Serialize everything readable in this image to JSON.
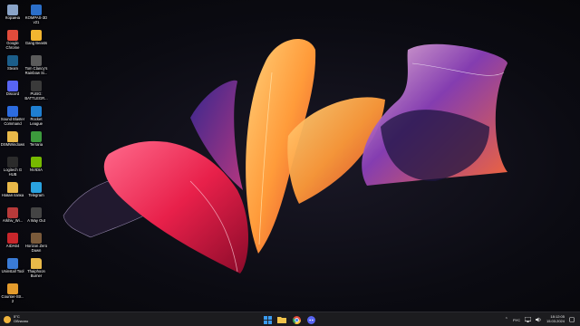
{
  "desktop": {
    "icons": [
      {
        "label": "Корзина",
        "icon": "recycle-bin-icon",
        "color": "#8aa4c8"
      },
      {
        "label": "KOMPAS-3D v21",
        "icon": "kompas-icon",
        "color": "#2b6fc9"
      },
      {
        "label": "Google Chrome",
        "icon": "chrome-icon",
        "color": "#e14b3b"
      },
      {
        "label": "Gang Beasts",
        "icon": "gang-beasts-icon",
        "color": "#f2b530"
      },
      {
        "label": "Steam",
        "icon": "steam-icon",
        "color": "#1b5e8a"
      },
      {
        "label": "Tom Clancy's Rainbow Si...",
        "icon": "rainbow-six-icon",
        "color": "#5b5b5b"
      },
      {
        "label": "Discord",
        "icon": "discord-icon",
        "color": "#5865f2"
      },
      {
        "label": "PUBG: BATTLEGR...",
        "icon": "pubg-icon",
        "color": "#3a3a3a"
      },
      {
        "label": "Sound Blaster Command",
        "icon": "sound-blaster-icon",
        "color": "#2d6cdf"
      },
      {
        "label": "Rocket League",
        "icon": "rocket-league-icon",
        "color": "#1f7fd1"
      },
      {
        "label": "DSMWindows",
        "icon": "folder-icon",
        "color": "#e9b949"
      },
      {
        "label": "Terraria",
        "icon": "terraria-icon",
        "color": "#3c9a3c"
      },
      {
        "label": "Logitech G HUB",
        "icon": "logitech-icon",
        "color": "#2b2b2b"
      },
      {
        "label": "NVIDIA",
        "icon": "nvidia-icon",
        "color": "#76b900"
      },
      {
        "label": "Новая папка",
        "icon": "folder-icon",
        "color": "#e9b949"
      },
      {
        "label": "Telegram",
        "icon": "telegram-icon",
        "color": "#2aa3e0"
      },
      {
        "label": "Arkhiv_Wi...",
        "icon": "archive-icon",
        "color": "#b73a3a"
      },
      {
        "label": "A Way Out",
        "icon": "a-way-out-icon",
        "color": "#444444"
      },
      {
        "label": "AIDA64",
        "icon": "aida64-icon",
        "color": "#c8262b"
      },
      {
        "label": "Horizon Zero Dawn",
        "icon": "horizon-icon",
        "color": "#7a5a3a"
      },
      {
        "label": "Uninstall Tool",
        "icon": "uninstall-tool-icon",
        "color": "#3a7bd5"
      },
      {
        "label": "Thaiphoon Burner",
        "icon": "folder-icon",
        "color": "#e9b949"
      },
      {
        "label": "Counter-Str... 2",
        "icon": "counter-strike-icon",
        "color": "#e39b2c"
      }
    ]
  },
  "taskbar": {
    "weather": {
      "temp": "5°C",
      "condition": "Облачно",
      "icon": "weather-sun-icon"
    },
    "apps": [
      {
        "name": "start",
        "icon": "windows-logo-icon",
        "color": "#3a9bf0"
      },
      {
        "name": "explorer",
        "icon": "file-explorer-icon",
        "color": "#f2c34b"
      },
      {
        "name": "chrome",
        "icon": "chrome-icon",
        "color": "#e14b3b"
      },
      {
        "name": "discord",
        "icon": "discord-icon",
        "color": "#5865f2"
      }
    ],
    "tray": {
      "lang": "РУС",
      "time": "18:12:05",
      "date": "15.03.2024"
    }
  }
}
